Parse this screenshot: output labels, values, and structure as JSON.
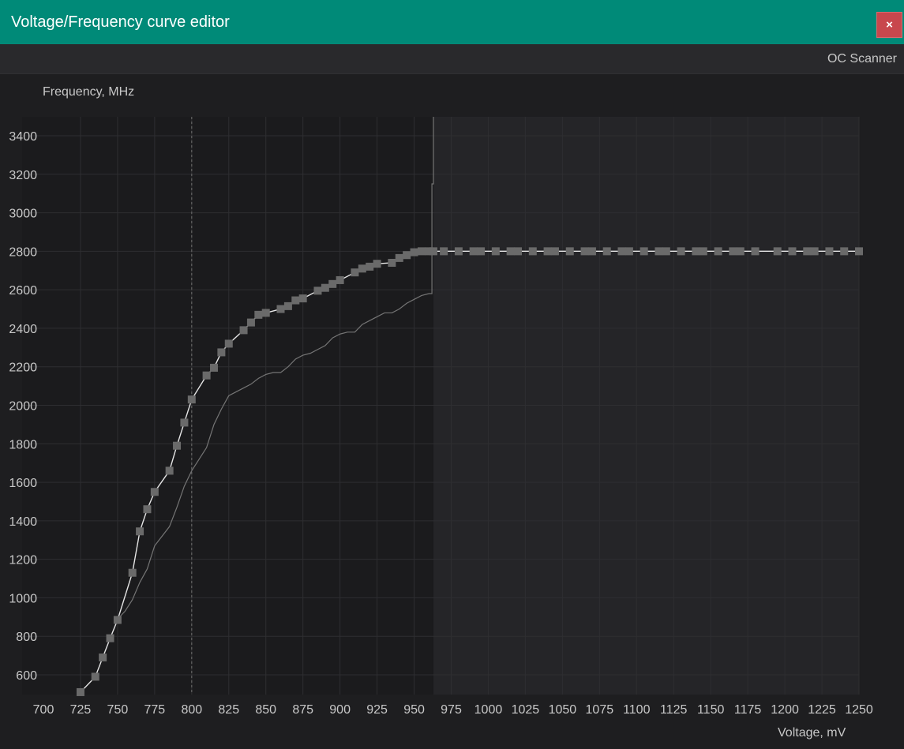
{
  "window": {
    "title": "Voltage/Frequency curve editor",
    "close_label": "×"
  },
  "toolbar": {
    "oc_scanner_label": "OC Scanner"
  },
  "colors": {
    "titlebar": "#008a78",
    "close_button": "#c8474d",
    "curve": "#e6e6e6",
    "curve_point": "#6a6a6a",
    "scan_line": "#757575"
  },
  "chart_data": {
    "type": "line",
    "ylabel": "Frequency, MHz",
    "xlabel": "Voltage, mV",
    "xlim": [
      700,
      1250
    ],
    "ylim": [
      500,
      3500
    ],
    "x_ticks": [
      700,
      725,
      750,
      775,
      800,
      825,
      850,
      875,
      900,
      925,
      950,
      975,
      1000,
      1025,
      1050,
      1075,
      1100,
      1125,
      1150,
      1175,
      1200,
      1225,
      1250
    ],
    "y_ticks": [
      600,
      800,
      1000,
      1200,
      1400,
      1600,
      1800,
      2000,
      2200,
      2400,
      2600,
      2800,
      3000,
      3200,
      3400
    ],
    "grid": true,
    "selected_voltage_marker": 800,
    "locked_region_start": 963,
    "series": [
      {
        "role": "vf-curve",
        "points": [
          [
            725,
            510
          ],
          [
            735,
            590
          ],
          [
            740,
            690
          ],
          [
            745,
            790
          ],
          [
            750,
            885
          ],
          [
            760,
            1130
          ],
          [
            765,
            1345
          ],
          [
            770,
            1460
          ],
          [
            775,
            1550
          ],
          [
            785,
            1660
          ],
          [
            790,
            1790
          ],
          [
            795,
            1910
          ],
          [
            800,
            2030
          ],
          [
            810,
            2155
          ],
          [
            815,
            2195
          ],
          [
            820,
            2275
          ],
          [
            825,
            2320
          ],
          [
            835,
            2390
          ],
          [
            840,
            2430
          ],
          [
            845,
            2470
          ],
          [
            850,
            2480
          ],
          [
            860,
            2500
          ],
          [
            865,
            2515
          ],
          [
            870,
            2545
          ],
          [
            875,
            2555
          ],
          [
            885,
            2595
          ],
          [
            890,
            2610
          ],
          [
            895,
            2630
          ],
          [
            900,
            2650
          ],
          [
            910,
            2690
          ],
          [
            915,
            2710
          ],
          [
            920,
            2720
          ],
          [
            925,
            2735
          ],
          [
            935,
            2740
          ],
          [
            940,
            2765
          ],
          [
            945,
            2780
          ],
          [
            950,
            2795
          ],
          [
            955,
            2800
          ],
          [
            960,
            2800
          ],
          [
            963,
            2800
          ],
          [
            970,
            2800
          ],
          [
            980,
            2800
          ],
          [
            990,
            2800
          ],
          [
            995,
            2800
          ],
          [
            1005,
            2800
          ],
          [
            1015,
            2800
          ],
          [
            1020,
            2800
          ],
          [
            1030,
            2800
          ],
          [
            1040,
            2800
          ],
          [
            1045,
            2800
          ],
          [
            1055,
            2800
          ],
          [
            1065,
            2800
          ],
          [
            1070,
            2800
          ],
          [
            1080,
            2800
          ],
          [
            1090,
            2800
          ],
          [
            1095,
            2800
          ],
          [
            1105,
            2800
          ],
          [
            1115,
            2800
          ],
          [
            1120,
            2800
          ],
          [
            1130,
            2800
          ],
          [
            1140,
            2800
          ],
          [
            1145,
            2800
          ],
          [
            1155,
            2800
          ],
          [
            1165,
            2800
          ],
          [
            1170,
            2800
          ],
          [
            1180,
            2800
          ],
          [
            1195,
            2800
          ],
          [
            1205,
            2800
          ],
          [
            1215,
            2800
          ],
          [
            1220,
            2800
          ],
          [
            1230,
            2800
          ],
          [
            1240,
            2800
          ],
          [
            1250,
            2800
          ]
        ]
      },
      {
        "role": "scan-curve",
        "points": [
          [
            750,
            890
          ],
          [
            755,
            930
          ],
          [
            760,
            990
          ],
          [
            765,
            1080
          ],
          [
            770,
            1150
          ],
          [
            775,
            1270
          ],
          [
            780,
            1320
          ],
          [
            785,
            1370
          ],
          [
            790,
            1470
          ],
          [
            795,
            1580
          ],
          [
            800,
            1660
          ],
          [
            805,
            1720
          ],
          [
            810,
            1780
          ],
          [
            815,
            1900
          ],
          [
            820,
            1980
          ],
          [
            825,
            2050
          ],
          [
            830,
            2070
          ],
          [
            835,
            2090
          ],
          [
            840,
            2110
          ],
          [
            845,
            2140
          ],
          [
            850,
            2160
          ],
          [
            855,
            2170
          ],
          [
            860,
            2170
          ],
          [
            865,
            2200
          ],
          [
            870,
            2240
          ],
          [
            875,
            2260
          ],
          [
            880,
            2270
          ],
          [
            885,
            2290
          ],
          [
            890,
            2310
          ],
          [
            895,
            2350
          ],
          [
            900,
            2370
          ],
          [
            905,
            2380
          ],
          [
            910,
            2380
          ],
          [
            915,
            2420
          ],
          [
            920,
            2440
          ],
          [
            925,
            2460
          ],
          [
            930,
            2480
          ],
          [
            935,
            2480
          ],
          [
            940,
            2500
          ],
          [
            945,
            2530
          ],
          [
            950,
            2550
          ],
          [
            955,
            2570
          ],
          [
            960,
            2580
          ],
          [
            962,
            2580
          ],
          [
            962,
            3150
          ],
          [
            963,
            3150
          ],
          [
            963,
            3500
          ]
        ]
      }
    ]
  }
}
